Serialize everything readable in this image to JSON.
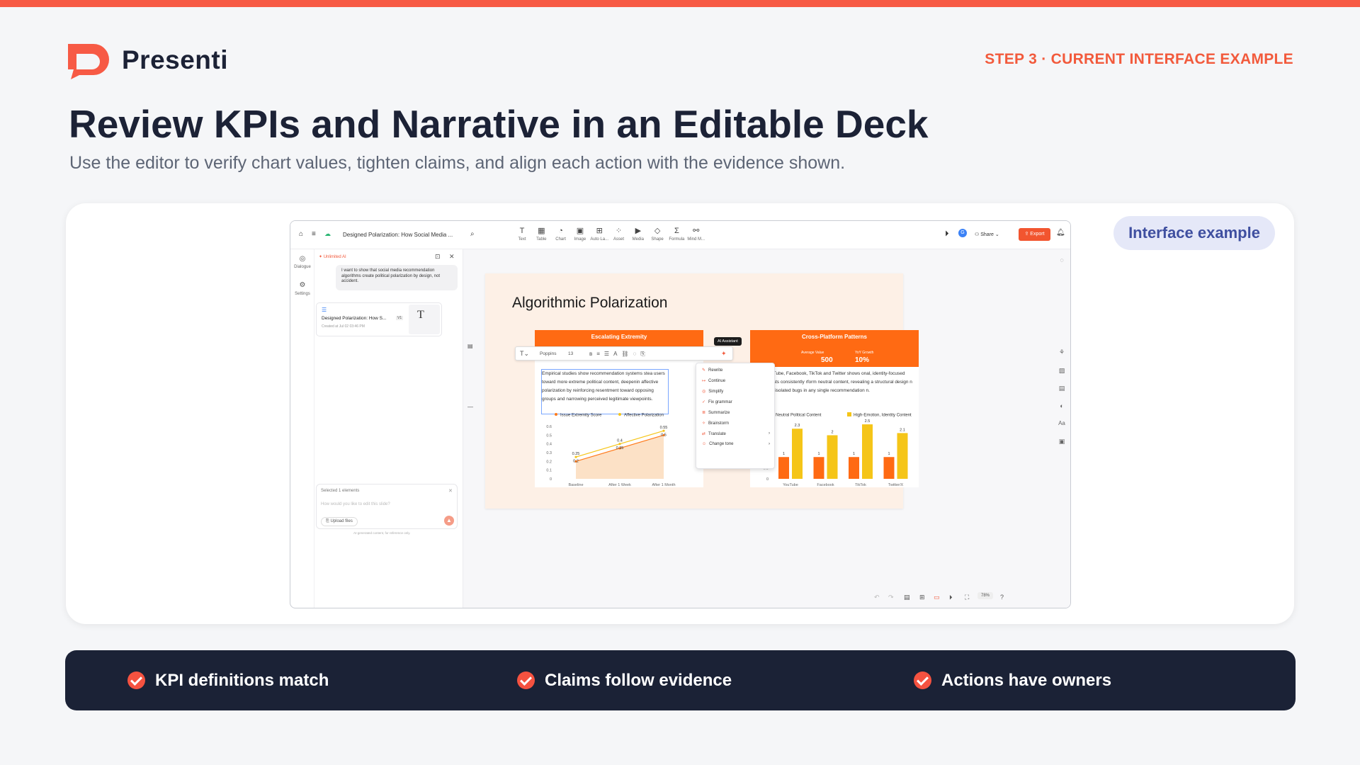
{
  "brand": {
    "name": "Presenti",
    "accent": "#f75a45"
  },
  "header": {
    "step": "STEP 3 · CURRENT INTERFACE EXAMPLE",
    "title": "Review KPIs and Narrative in an Editable Deck",
    "subtitle": "Use the editor to verify chart values, tighten claims, and align each action with the evidence shown."
  },
  "pill": {
    "label": "Interface example"
  },
  "editor": {
    "doc_title": "Designed Polarization: How Social Media ...",
    "tools": [
      {
        "icon": "T",
        "label": "Text"
      },
      {
        "icon": "▦",
        "label": "Table"
      },
      {
        "icon": "◔",
        "label": "Chart"
      },
      {
        "icon": "▣",
        "label": "Image"
      },
      {
        "icon": "⊞",
        "label": "Auto La..."
      },
      {
        "icon": "⁘",
        "label": "Asset"
      },
      {
        "icon": "▶",
        "label": "Media"
      },
      {
        "icon": "◇",
        "label": "Shape"
      },
      {
        "icon": "Σ",
        "label": "Formula"
      },
      {
        "icon": "⚯",
        "label": "Mind M..."
      }
    ],
    "share_label": "Share",
    "export_label": "Export",
    "rail": {
      "dialogue": "Dialogue",
      "settings": "Settings"
    },
    "chat": {
      "badge": "Unlimited AI",
      "message": "I want to show that social media recommendation algorithms create political polarization by design, not accident.",
      "doc_card_title": "Designed Polarization: How S...",
      "doc_card_version": "V1",
      "doc_card_date": "Created at Jul 02 03:46 PM",
      "selected": "Selected 1 elements",
      "prompt_placeholder": "How would you like to edit this slide?",
      "upload_label": "Upload files",
      "disclaimer": "AI-generated content, for reference only."
    },
    "zoom": "78%",
    "slide": {
      "title": "Algorithmic Polarization",
      "left_card_title": "Escalating Extremity",
      "right_card_title": "Cross-Platform Patterns",
      "kpi1_label": "Average Value",
      "kpi1_value": "500",
      "kpi2_label": "YoY Growth",
      "kpi2_value": "10%",
      "left_text": "Empirical studies show recommendation systems stea users toward more extreme political content, deepenin affective polarization by reinforcing resentment toward opposing groups and narrowing perceived legitimate viewpoints.",
      "right_text": "rch on YouTube, Facebook, TikTok and Twitter shows onal, identity-focused political posts consistently rform neutral content, revealing a structural design n rather than isolated bugs in any single recommendation n.",
      "format_font": "Poppins",
      "format_size": "13",
      "ai_tooltip": "AI Assistant",
      "ai_menu": [
        "Rewrite",
        "Continue",
        "Simplify",
        "Fix grammar",
        "Summarize",
        "Brainstorm",
        "Translate",
        "Change tone"
      ]
    }
  },
  "chart_data": [
    {
      "type": "line",
      "categories": [
        "Baseline",
        "After 1 Week",
        "After 1 Month"
      ],
      "series": [
        {
          "name": "Issue Extremity Score",
          "values": [
            0.2,
            0.35,
            0.5
          ],
          "color": "#ff7a1a"
        },
        {
          "name": "Affective Polarization",
          "values": [
            0.25,
            0.4,
            0.55
          ],
          "color": "#f5c518"
        }
      ],
      "data_labels": [
        [
          "0.2",
          "0.35",
          "0.5"
        ],
        [
          "0.25",
          "0.4",
          "0.55"
        ]
      ],
      "yticks": [
        "0",
        "0.1",
        "0.2",
        "0.3",
        "0.4",
        "0.5",
        "0.6"
      ],
      "ylim": [
        0,
        0.6
      ]
    },
    {
      "type": "bar",
      "categories": [
        "YouTube",
        "Facebook",
        "TikTok",
        "Twitter/X"
      ],
      "series": [
        {
          "name": "Neutral Political Content",
          "values": [
            1,
            1,
            1,
            1
          ],
          "color": "#ff6a13"
        },
        {
          "name": "High-Emotion, Identity Content",
          "values": [
            2.3,
            2,
            2.5,
            2.1
          ],
          "color": "#f5c518"
        }
      ],
      "data_labels": [
        [
          "1",
          "1",
          "1",
          "1"
        ],
        [
          "2.3",
          "2",
          "2.5",
          "2.1"
        ]
      ],
      "yticks": [
        "0",
        "0.5",
        "1"
      ],
      "ylim": [
        0,
        2.6
      ]
    }
  ],
  "footer": {
    "items": [
      "KPI definitions match",
      "Claims follow evidence",
      "Actions have owners"
    ]
  }
}
